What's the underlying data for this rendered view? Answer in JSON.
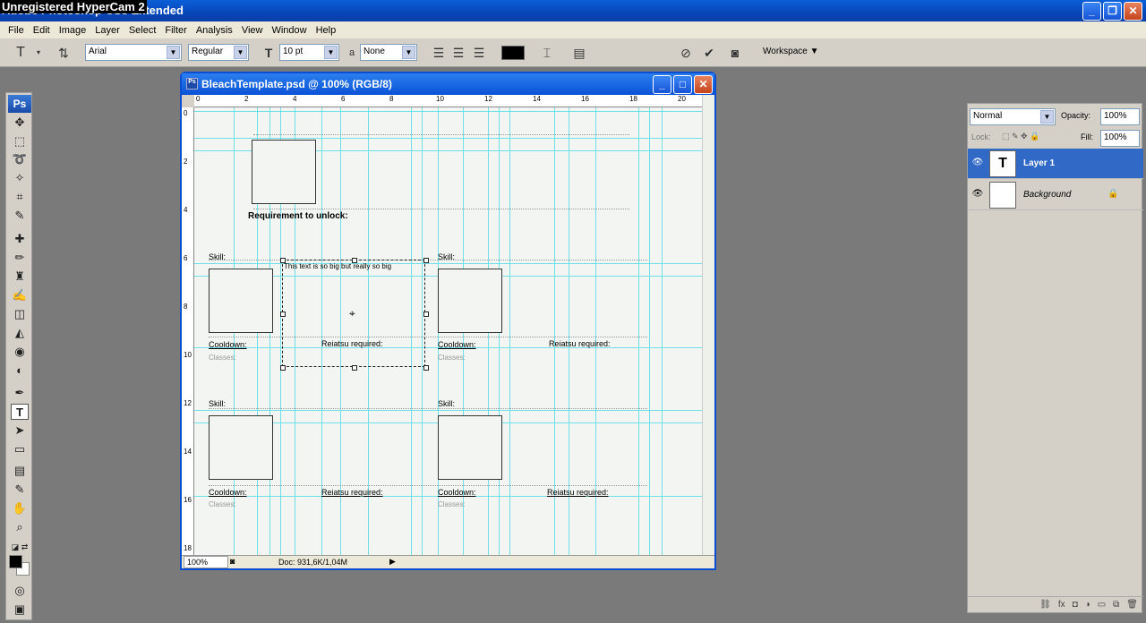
{
  "window": {
    "title": "Adobe Photoshop CS3 Extended",
    "overlay": "Unregistered HyperCam 2"
  },
  "menu": [
    "File",
    "Edit",
    "Image",
    "Layer",
    "Select",
    "Filter",
    "Analysis",
    "View",
    "Window",
    "Help"
  ],
  "options": {
    "font_family": "Arial",
    "font_style": "Regular",
    "font_size": "10 pt",
    "aa_label": "a",
    "antialias": "None",
    "workspace": "Workspace"
  },
  "document": {
    "title": "BleachTemplate.psd @ 100% (RGB/8)",
    "zoom": "100%",
    "doc_info": "Doc: 931,6K/1,04M",
    "hruler": [
      "0",
      "2",
      "4",
      "6",
      "8",
      "10",
      "12",
      "14",
      "16",
      "18",
      "20"
    ],
    "vruler": [
      "0",
      "2",
      "4",
      "6",
      "8",
      "10",
      "12",
      "14",
      "16",
      "18"
    ],
    "canvas": {
      "requirement": "Requirement to unlock:",
      "skill1": "Skill:",
      "skill2": "Skill:",
      "skill3": "Skill:",
      "skill4": "Skill:",
      "textbox": "This text is so big but really so big",
      "cooldown1": "Cooldown:",
      "cooldown2": "Cooldown:",
      "cooldown3": "Cooldown:",
      "cooldown4": "Cooldown:",
      "reiatsu1": "Reiatsu required:",
      "reiatsu2": "Reiatsu required:",
      "reiatsu3": "Reiatsu required:",
      "reiatsu4": "Reiatsu required:",
      "classes1": "Classes:",
      "classes2": "Classes:",
      "classes3": "Classes:",
      "classes4": "Classes:"
    }
  },
  "layers_panel": {
    "blend_mode": "Normal",
    "opacity_label": "Opacity:",
    "opacity": "100%",
    "lock_label": "Lock:",
    "fill_label": "Fill:",
    "fill": "100%",
    "layers": [
      {
        "name": "Layer 1",
        "thumb": "T"
      },
      {
        "name": "Background",
        "thumb": ""
      }
    ]
  },
  "tools_logo": "Ps"
}
